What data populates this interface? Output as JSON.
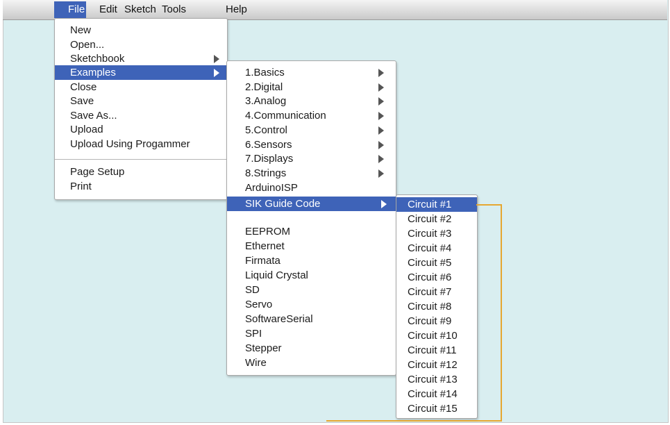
{
  "menubar": [
    "File",
    "Edit",
    "Sketch",
    "Tools",
    "Help"
  ],
  "file_menu": {
    "group1": [
      "New",
      "Open...",
      "Sketchbook",
      "Examples",
      "Close",
      "Save",
      "Save As...",
      "Upload",
      "Upload Using Progammer"
    ],
    "group2": [
      "Page Setup",
      "Print"
    ]
  },
  "examples_menu": {
    "items": [
      "1.Basics",
      "2.Digital",
      "3.Analog",
      "4.Communication",
      "5.Control",
      "6.Sensors",
      "7.Displays",
      "8.Strings",
      "ArduinoISP",
      "SIK Guide Code"
    ],
    "libraries": [
      "EEPROM",
      "Ethernet",
      "Firmata",
      "Liquid Crystal",
      "SD",
      "Servo",
      "SoftwareSerial",
      "SPI",
      "Stepper",
      "Wire"
    ]
  },
  "sik_menu": {
    "items": [
      "Circuit #1",
      "Circuit #2",
      "Circuit #3",
      "Circuit #4",
      "Circuit #5",
      "Circuit #6",
      "Circuit #7",
      "Circuit #8",
      "Circuit #9",
      "Circuit #10",
      "Circuit #11",
      "Circuit #12",
      "Circuit #13",
      "Circuit #14",
      "Circuit #15"
    ]
  },
  "colors": {
    "highlight": "#3e63b8",
    "background": "#d9eef0",
    "callout": "#e6a730"
  }
}
